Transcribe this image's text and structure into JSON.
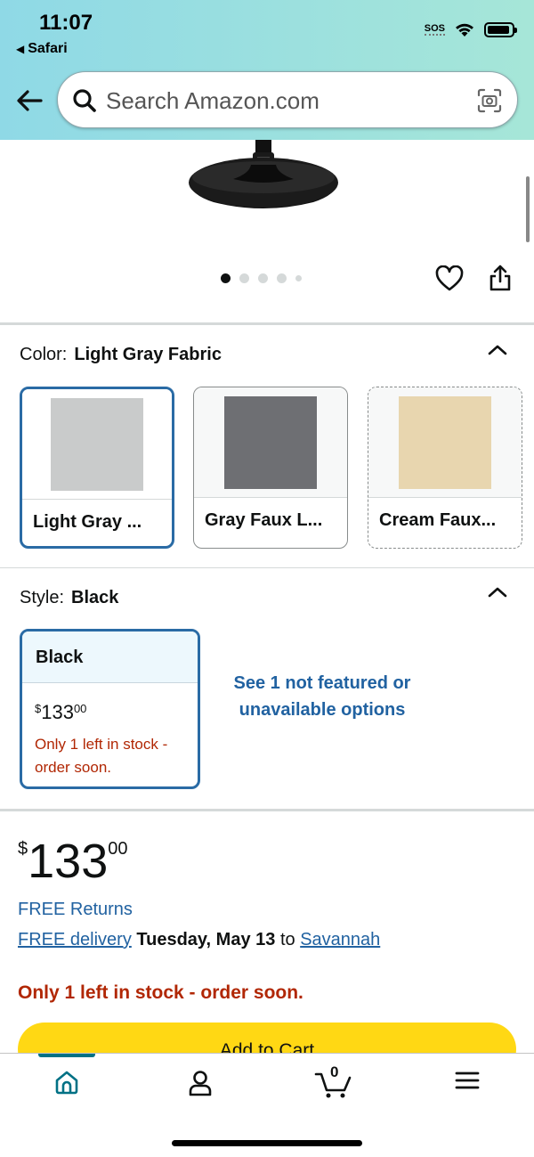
{
  "status_bar": {
    "time": "11:07",
    "back_app": "Safari",
    "sos": "SOS"
  },
  "search": {
    "placeholder": "Search Amazon.com"
  },
  "gallery": {
    "image_count": 5,
    "active_index": 0
  },
  "color": {
    "label": "Color:",
    "selected": "Light Gray Fabric",
    "options": [
      {
        "label": "Light Gray ...",
        "swatch": "#c9cbcb"
      },
      {
        "label": "Gray Faux L...",
        "swatch": "#6e6f73"
      },
      {
        "label": "Cream Faux...",
        "swatch": "#e8d6af"
      }
    ]
  },
  "style": {
    "label": "Style:",
    "selected": "Black",
    "card": {
      "name": "Black",
      "price_currency": "$",
      "price_whole": "133",
      "price_fraction": "00",
      "stock": "Only 1 left in stock - order soon."
    },
    "see_more": "See 1 not featured or unavailable options"
  },
  "buybox": {
    "currency": "$",
    "whole": "133",
    "fraction": "00",
    "free_returns": "FREE Returns",
    "free_delivery": "FREE delivery",
    "delivery_date": "Tuesday, May 13",
    "delivery_to": "to",
    "location": "Savannah",
    "stock": "Only 1 left in stock - order soon.",
    "add_to_cart": "Add to Cart"
  },
  "nav": {
    "cart_count": "0"
  },
  "colors": {
    "link": "#2162a1",
    "alert": "#b12704",
    "accent": "#2a6ba5",
    "cart_button": "#ffd814"
  }
}
